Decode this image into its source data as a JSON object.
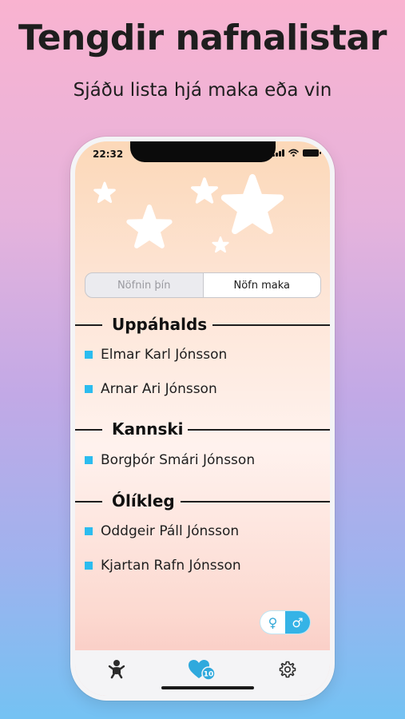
{
  "promo": {
    "headline": "Tengdir nafnalistar",
    "subheadline": "Sjáðu lista hjá maka eða vin"
  },
  "status_bar": {
    "time": "22:32"
  },
  "segmented": {
    "options": [
      {
        "label": "Nöfnin þín",
        "selected": false
      },
      {
        "label": "Nöfn maka",
        "selected": true
      }
    ]
  },
  "sections": [
    {
      "title": "Uppáhalds",
      "names": [
        "Elmar Karl Jónsson",
        "Arnar Ari Jónsson"
      ]
    },
    {
      "title": "Kannski",
      "names": [
        "Borgþór Smári Jónsson"
      ]
    },
    {
      "title": "Ólíkleg",
      "names": [
        "Oddgeir Páll Jónsson",
        "Kjartan Rafn Jónsson"
      ]
    }
  ],
  "gender_toggle": {
    "female_symbol": "♀",
    "male_symbol": "♂",
    "selected": "male"
  },
  "tab_bar": {
    "tabs": [
      {
        "icon": "baby-icon"
      },
      {
        "icon": "hearts-icon",
        "badge": "10",
        "selected": true
      },
      {
        "icon": "gear-icon"
      }
    ]
  },
  "colors": {
    "accent": "#2bbcef",
    "toggle_selected": "#35b3e6",
    "tab_selected": "#2fa9dd",
    "tab_inactive": "#2b2b2b"
  }
}
